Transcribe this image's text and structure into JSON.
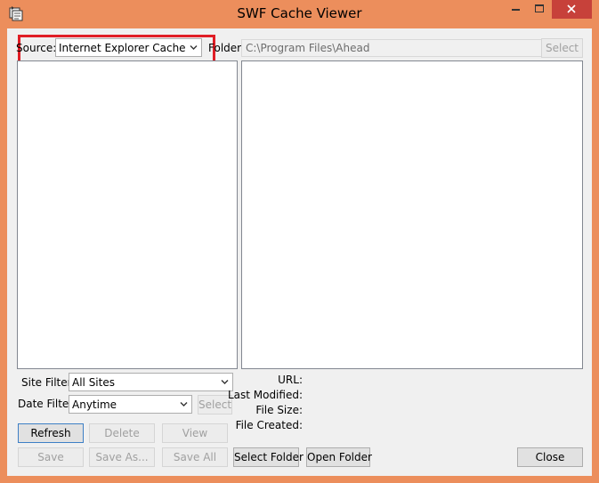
{
  "window": {
    "title": "SWF Cache Viewer",
    "colors": {
      "frame": "#ec8e5c",
      "close_button": "#c7413a",
      "highlight": "#e01e26"
    },
    "icons": [
      "app-icon",
      "minimize-icon",
      "maximize-icon",
      "close-icon"
    ]
  },
  "top": {
    "source_label": "Source:",
    "source_value": "Internet Explorer Cache",
    "folder_label": "Folder:",
    "folder_value": "C:\\Program Files\\Ahead",
    "folder_select_label": "Select"
  },
  "filters": {
    "site_filter_label": "Site Filter:",
    "site_filter_value": "All Sites",
    "date_filter_label": "Date Filter:",
    "date_filter_value": "Anytime",
    "date_select_label": "Select"
  },
  "details": {
    "url_label": "URL:",
    "last_modified_label": "Last Modified:",
    "file_size_label": "File Size:",
    "file_created_label": "File Created:"
  },
  "buttons": {
    "refresh": "Refresh",
    "delete": "Delete",
    "view": "View",
    "save": "Save",
    "save_as": "Save As...",
    "save_all": "Save All",
    "select_folder": "Select Folder",
    "open_folder": "Open Folder",
    "close": "Close"
  }
}
